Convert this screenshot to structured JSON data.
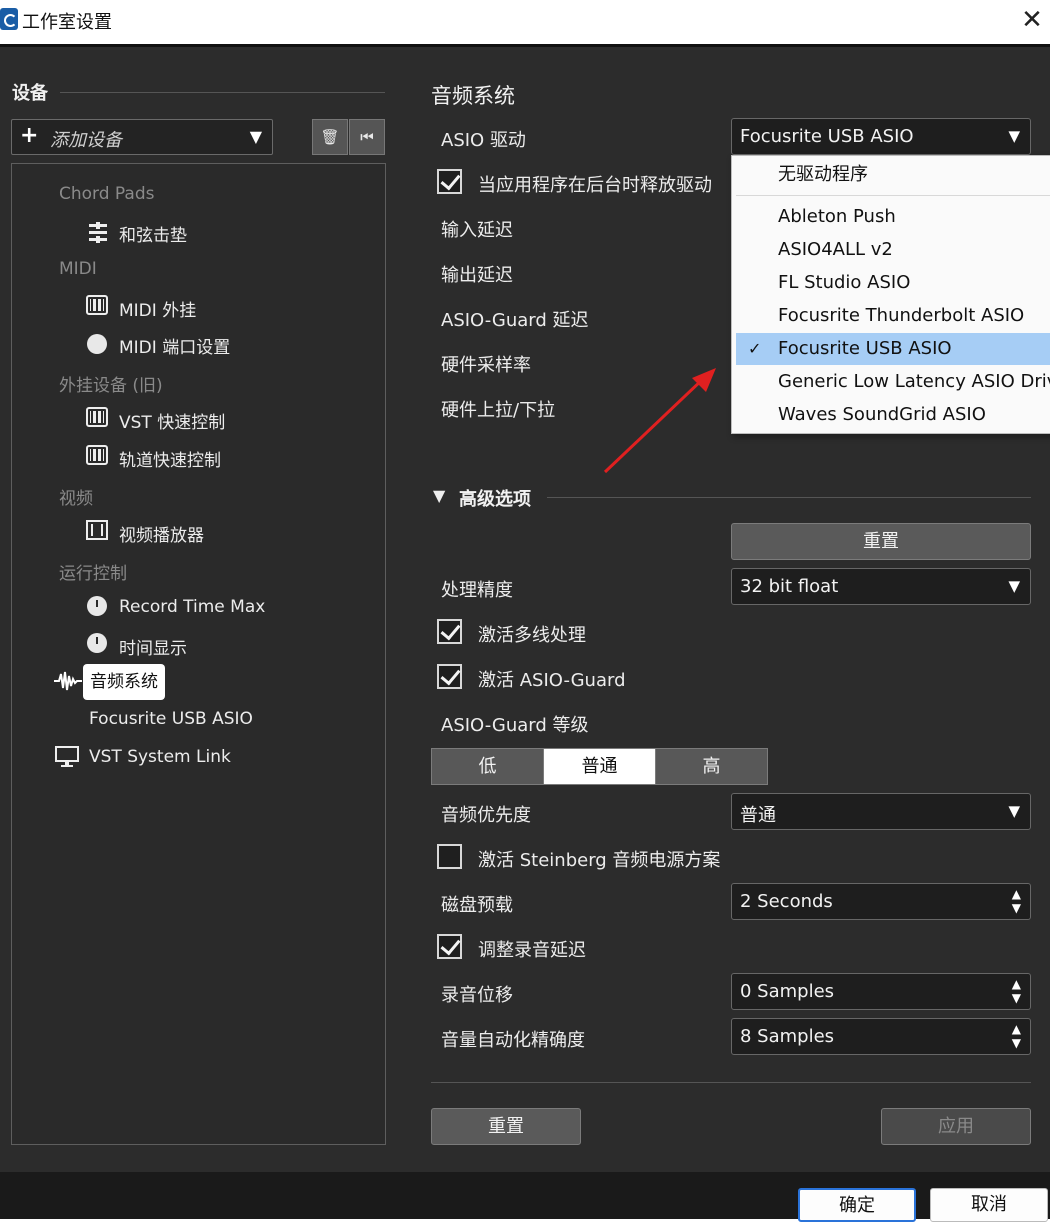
{
  "window": {
    "title": "工作室设置",
    "close": "✕"
  },
  "left": {
    "header": "设备",
    "add_device_label": "添加设备",
    "add_device_plus": "+",
    "add_device_arrow": "▼",
    "delete_icon": "🗑",
    "reset_icon": "⏮",
    "tree": {
      "cat_chord": "Chord Pads",
      "chord_pads_item": "和弦击垫",
      "cat_midi": "MIDI",
      "midi_remote": "MIDI 外挂",
      "midi_port": "MIDI 端口设置",
      "cat_external": "外挂设备 (旧)",
      "vst_quick": "VST 快速控制",
      "track_quick": "轨道快速控制",
      "cat_video": "视频",
      "video_player": "视频播放器",
      "cat_transport": "运行控制",
      "record_time_max": "Record Time Max",
      "time_display": "时间显示",
      "audio_system": "音频系统",
      "focusrite": "Focusrite USB ASIO",
      "vst_link": "VST System Link"
    }
  },
  "right": {
    "title": "音频系统",
    "asio_driver_label": "ASIO 驱动",
    "asio_driver_value": "Focusrite USB ASIO",
    "release_driver_label": "当应用程序在后台时释放驱动",
    "input_latency": "输入延迟",
    "output_latency": "输出延迟",
    "asio_guard_latency": "ASIO-Guard 延迟",
    "hw_sample_rate": "硬件采样率",
    "hw_pulldown": "硬件上拉/下拉",
    "advanced_label": "高级选项",
    "advanced_triangle": "▼",
    "reset_top": "重置",
    "precision_label": "处理精度",
    "precision_value": "32 bit float",
    "multithread_label": "激活多线处理",
    "asioguard_enable": "激活 ASIO-Guard",
    "asioguard_level_label": "ASIO-Guard 等级",
    "level_low": "低",
    "level_normal": "普通",
    "level_high": "高",
    "priority_label": "音频优先度",
    "priority_value": "普通",
    "power_scheme_label": "激活 Steinberg 音频电源方案",
    "disk_preload_label": "磁盘预载",
    "disk_preload_value": "2 Seconds",
    "adjust_latency_label": "调整录音延迟",
    "record_shift_label": "录音位移",
    "record_shift_value": "0 Samples",
    "automation_label": "音量自动化精确度",
    "automation_value": "8 Samples",
    "reset_bottom": "重置",
    "apply": "应用",
    "caret": "▼",
    "spin": "▲\n▼"
  },
  "popup": {
    "none": "无驱动程序",
    "options": [
      "Ableton Push",
      "ASIO4ALL v2",
      "FL Studio ASIO",
      "Focusrite Thunderbolt ASIO",
      "Focusrite USB ASIO",
      "Generic Low Latency ASIO Driver",
      "Waves SoundGrid ASIO"
    ],
    "check": "✓"
  },
  "dialog": {
    "ok": "确定",
    "cancel": "取消"
  },
  "colors": {
    "accent": "#2a73d9",
    "selection": "#a6cdf5",
    "panel": "#2c2c2c",
    "arrow": "#e02020"
  }
}
